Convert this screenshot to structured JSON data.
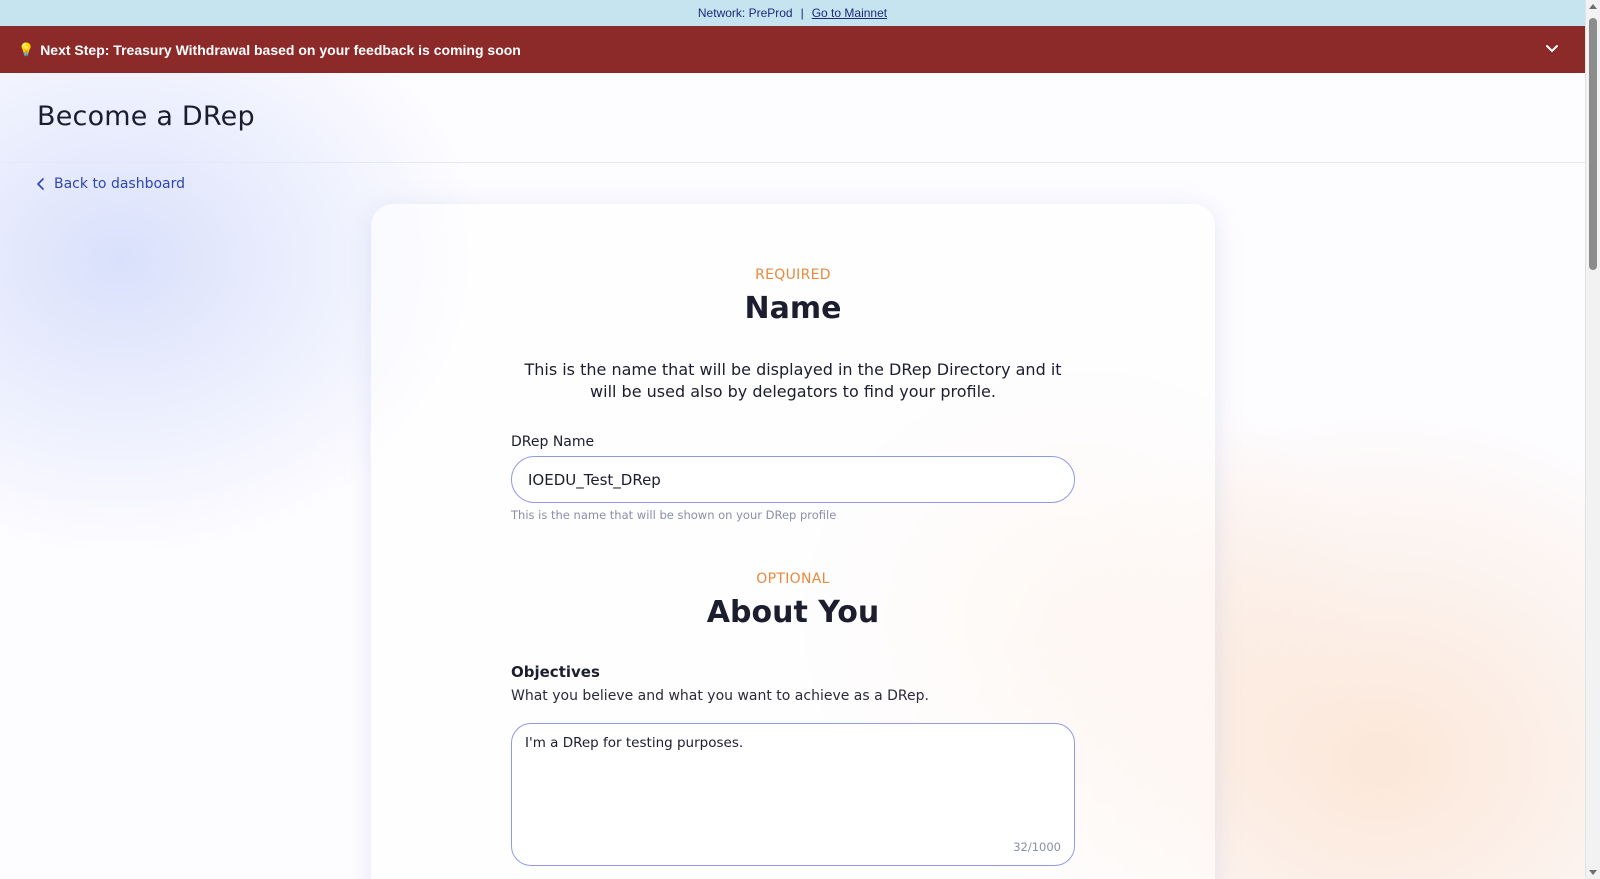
{
  "network_bar": {
    "network_text": "Network: PreProd",
    "separator": "|",
    "mainnet_link": "Go to Mainnet"
  },
  "banner": {
    "icon": "lightbulb-icon",
    "text": "Next Step: Treasury Withdrawal based on your feedback is coming soon",
    "background": "#8b2a28"
  },
  "header": {
    "title": "Become a DRep"
  },
  "nav": {
    "back_label": "Back to dashboard"
  },
  "name_section": {
    "tag": "REQUIRED",
    "title": "Name",
    "description": "This is the name that will be displayed in the DRep Directory and it will be used also by delegators to find your profile.",
    "field_label": "DRep Name",
    "field_value": "IOEDU_Test_DRep",
    "hint": "This is the name that will be shown on your DRep profile"
  },
  "about_section": {
    "tag": "OPTIONAL",
    "title": "About You",
    "objectives_title": "Objectives",
    "objectives_subtitle": "What you believe and what you want to achieve as a DRep.",
    "objectives_value": "I'm a DRep for testing purposes.",
    "objectives_counter": "32/1000"
  },
  "colors": {
    "accent_orange": "#e8893c",
    "link_blue": "#3045b0",
    "input_border": "#8e9be6"
  }
}
